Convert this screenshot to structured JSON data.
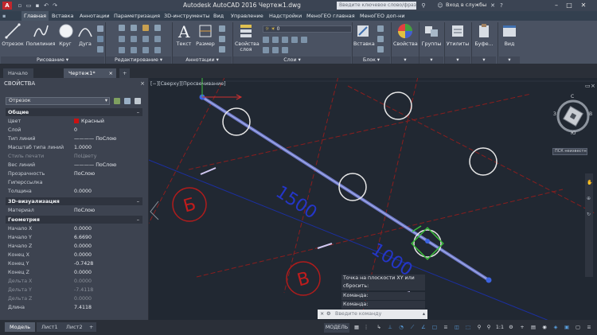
{
  "titlebar": {
    "logo": "A",
    "title": "Autodesk AutoCAD 2016   Чертеж1.dwg",
    "search_placeholder": "Введите ключевое слово/фразу",
    "signin": "Вход в службы",
    "help": "?"
  },
  "ribbon_tabs": [
    "Главная",
    "Вставка",
    "Аннотации",
    "Параметризация",
    "3D-инструменты",
    "Вид",
    "Управление",
    "Надстройки",
    "МеноГЕО главная",
    "МеноГЕО доп-ни"
  ],
  "ribbon": {
    "draw": {
      "line": "Отрезок",
      "polyline": "Полилиния",
      "circle": "Круг",
      "arc": "Дуга",
      "panel": "Рисование"
    },
    "modify_panel": "Редактирование",
    "annot": {
      "text": "Текст",
      "dimension": "Размер",
      "panel": "Аннотации"
    },
    "layers": {
      "props": "Свойства слоя",
      "current": "0",
      "panel": "Слои"
    },
    "block": {
      "insert": "Вставка",
      "panel": "Блок"
    },
    "properties": "Свойства",
    "groups": "Группы",
    "utilities": "Утилиты",
    "clipboard": "Буфе...",
    "view": "Вид"
  },
  "file_tabs": {
    "start": "Начало",
    "drawing": "Чертеж1*",
    "add": "+"
  },
  "properties": {
    "title": "СВОЙСТВА",
    "object": "Отрезок",
    "general_title": "Общие",
    "general": [
      {
        "k": "Цвет",
        "v": "Красный"
      },
      {
        "k": "Слой",
        "v": "0"
      },
      {
        "k": "Тип линий",
        "v": "———— ПоСлою"
      },
      {
        "k": "Масштаб типа линий",
        "v": "1.0000"
      },
      {
        "k": "Стиль печати",
        "v": "ПоЦвету"
      },
      {
        "k": "Вес линий",
        "v": "———— ПоСлою"
      },
      {
        "k": "Прозрачность",
        "v": "ПоСлою"
      },
      {
        "k": "Гиперссылка",
        "v": ""
      },
      {
        "k": "Толщина",
        "v": "0.0000"
      }
    ],
    "viz_title": "3D-визуализация",
    "viz": [
      {
        "k": "Материал",
        "v": "ПоСлою"
      }
    ],
    "geom_title": "Геометрия",
    "geom": [
      {
        "k": "Начало X",
        "v": "0.0000"
      },
      {
        "k": "Начало Y",
        "v": "6.6690"
      },
      {
        "k": "Начало Z",
        "v": "0.0000"
      },
      {
        "k": "Конец X",
        "v": "0.0000"
      },
      {
        "k": "Конец Y",
        "v": "-0.7428"
      },
      {
        "k": "Конец Z",
        "v": "0.0000"
      },
      {
        "k": "Дельта X",
        "v": "0.0000"
      },
      {
        "k": "Дельта Y",
        "v": "-7.4118"
      },
      {
        "k": "Дельта Z",
        "v": "0.0000"
      },
      {
        "k": "Длина",
        "v": "7.4118"
      }
    ],
    "color_swatch": "#cc1111"
  },
  "viewport_label": "[−][Сверху][Просвечивание]",
  "drawing": {
    "labels": {
      "b_letter": "Б",
      "v_letter": "В",
      "dim1": "1500",
      "dim2": "1000"
    },
    "viewcube": {
      "n": "С",
      "s": "Ю",
      "w": "З",
      "e": "В",
      "wcs": "ПСК неизвестно"
    }
  },
  "command": {
    "prompt": "Точка на плоскости XY или сбросить:",
    "history": [
      "Команда:",
      "Команда:"
    ],
    "input_placeholder": "Введите команду"
  },
  "layout_tabs": {
    "model": "Модель",
    "l1": "Лист1",
    "l2": "Лист2",
    "add": "+"
  },
  "statusbar": {
    "model": "МОДЕЛЬ",
    "scale": "1:1"
  }
}
